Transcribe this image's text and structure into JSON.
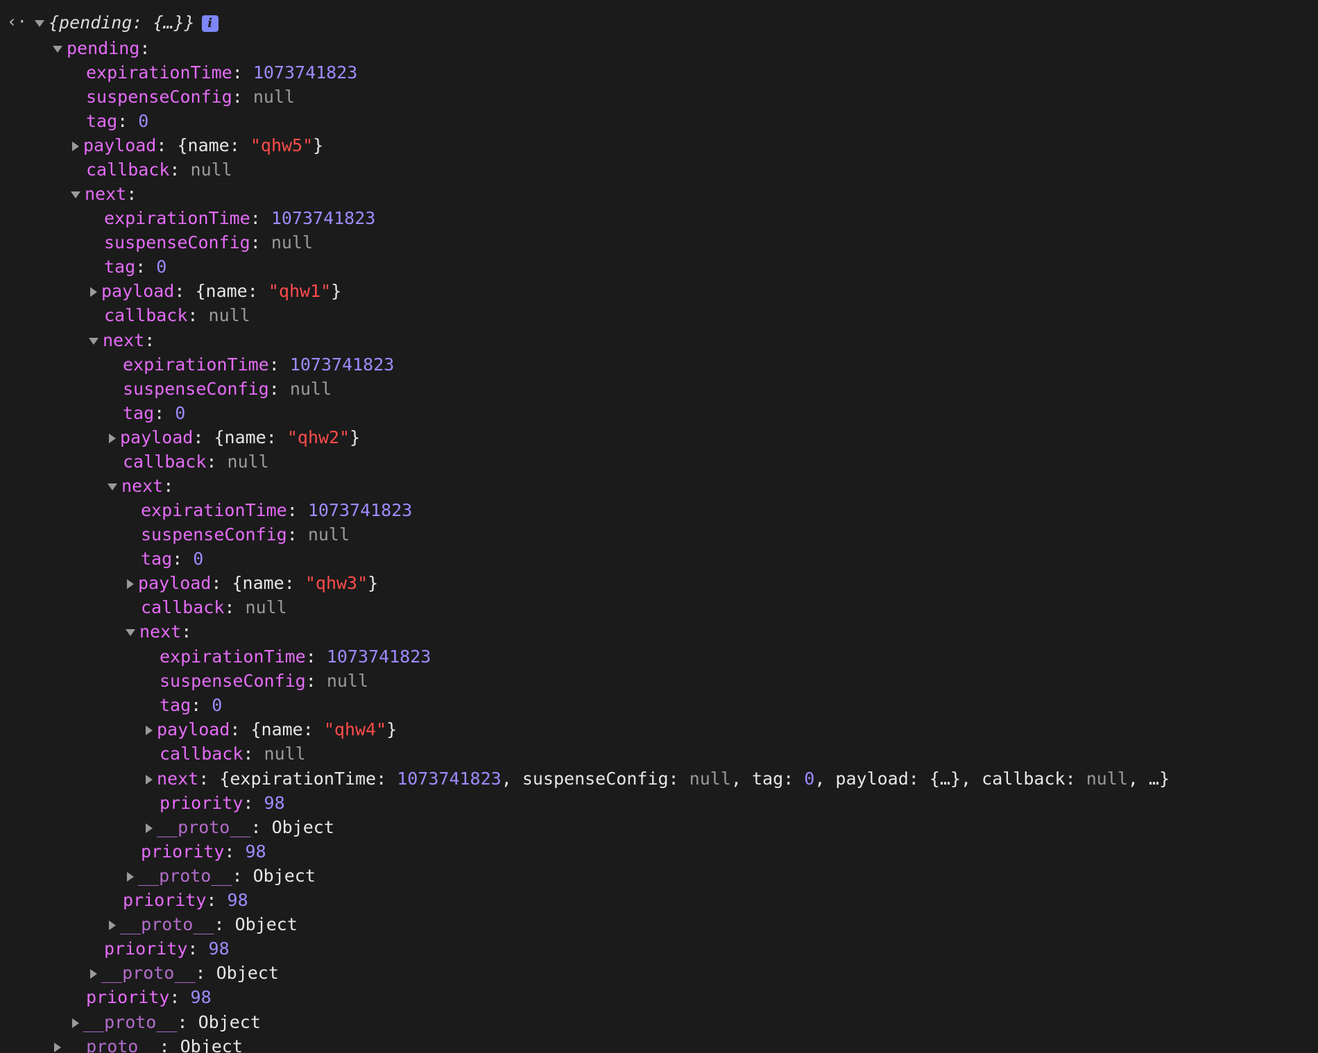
{
  "root": {
    "summary": "{pending: {…}}",
    "info_badge": "i",
    "back_arrow": "‹·"
  },
  "labels": {
    "pending": "pending",
    "expirationTime": "expirationTime",
    "suspenseConfig": "suspenseConfig",
    "tag": "tag",
    "payload": "payload",
    "callback": "callback",
    "next": "next",
    "priority": "priority",
    "proto": "__proto__"
  },
  "values": {
    "expirationTime": "1073741823",
    "suspenseConfig": "null",
    "tag": "0",
    "callback": "null",
    "priority": "98",
    "proto": "Object"
  },
  "payloads": [
    "\"qhw5\"",
    "\"qhw1\"",
    "\"qhw2\"",
    "\"qhw3\"",
    "\"qhw4\""
  ],
  "payload_name_key": "name",
  "collapsed_next": {
    "expirationTime": "1073741823",
    "suspenseConfig": "null",
    "tag": "0",
    "payload": "{…}",
    "callback": "null",
    "ellipsis": "…"
  }
}
